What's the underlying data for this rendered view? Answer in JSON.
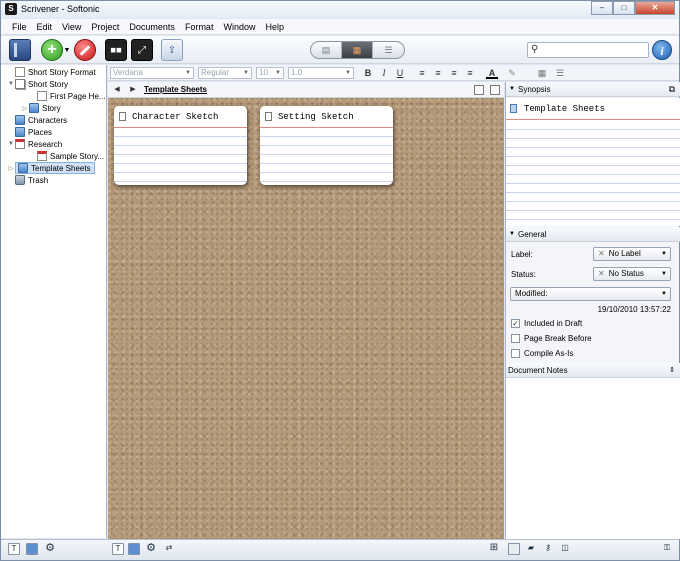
{
  "window": {
    "title": "Scrivener - Softonic",
    "controls": {
      "minimize": "–",
      "maximize": "□",
      "close": "✕"
    }
  },
  "menu": [
    "File",
    "Edit",
    "View",
    "Project",
    "Documents",
    "Format",
    "Window",
    "Help"
  ],
  "toolbar": {
    "icons": [
      "binder-icon",
      "add-icon",
      "delete-icon",
      "keywords-icon",
      "fullscreen-icon",
      "compile-icon"
    ],
    "view_modes": [
      "document",
      "corkboard",
      "outliner"
    ],
    "active_view": "corkboard",
    "search_placeholder": ""
  },
  "format_bar": {
    "font": "Verdana",
    "style": "Regular",
    "size": "10",
    "line_spacing": "1.0",
    "bold": "B",
    "italic": "I",
    "underline": "U"
  },
  "binder": [
    {
      "label": "Short Story Format",
      "type": "doc",
      "indent": 0,
      "twisty": "",
      "selected": false
    },
    {
      "label": "Short Story",
      "type": "draft",
      "indent": 0,
      "twisty": "▼",
      "selected": false
    },
    {
      "label": "First Page He...",
      "type": "doc",
      "indent": 2,
      "twisty": "",
      "selected": false
    },
    {
      "label": "Story",
      "type": "folder",
      "indent": 1,
      "twisty": "▷",
      "selected": false
    },
    {
      "label": "Characters",
      "type": "folder",
      "indent": 0,
      "twisty": "",
      "selected": false
    },
    {
      "label": "Places",
      "type": "folder",
      "indent": 0,
      "twisty": "",
      "selected": false
    },
    {
      "label": "Research",
      "type": "research",
      "indent": 0,
      "twisty": "▼",
      "selected": false
    },
    {
      "label": "Sample Story...",
      "type": "research",
      "indent": 2,
      "twisty": "",
      "selected": false
    },
    {
      "label": "Template Sheets",
      "type": "folder",
      "indent": 0,
      "twisty": "▷",
      "selected": true
    },
    {
      "label": "Trash",
      "type": "trash",
      "indent": 0,
      "twisty": "",
      "selected": false
    }
  ],
  "editor": {
    "title": "Template Sheets",
    "cards": [
      {
        "title": "Character Sketch"
      },
      {
        "title": "Setting Sketch"
      }
    ]
  },
  "inspector": {
    "synopsis_header": "Synopsis",
    "synopsis_title": "Template Sheets",
    "general_header": "General",
    "label_label": "Label:",
    "label_value": "No Label",
    "status_label": "Status:",
    "status_value": "No Status",
    "date_select": "Modified:",
    "date_value": "19/10/2010 13:57:22",
    "checks": [
      {
        "label": "Included in Draft",
        "checked": true
      },
      {
        "label": "Page Break Before",
        "checked": false
      },
      {
        "label": "Compile As-Is",
        "checked": false
      }
    ],
    "notes_header": "Document Notes"
  }
}
